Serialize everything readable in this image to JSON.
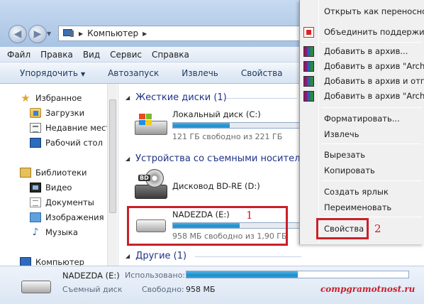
{
  "address": {
    "location": "Компьютер"
  },
  "menubar": {
    "items": [
      "Файл",
      "Правка",
      "Вид",
      "Сервис",
      "Справка"
    ]
  },
  "toolbar": {
    "organize": "Упорядочить",
    "autoplay": "Автозапуск",
    "eject": "Извлечь",
    "properties": "Свойства"
  },
  "navpane": {
    "favorites": "Избранное",
    "downloads": "Загрузки",
    "recent": "Недавние места",
    "desktop": "Рабочий стол",
    "libraries": "Библиотеки",
    "video": "Видео",
    "documents": "Документы",
    "images": "Изображения",
    "music": "Музыка",
    "computer": "Компьютер"
  },
  "content": {
    "hard_drives_header": "Жесткие диски (1)",
    "local_disk": {
      "name": "Локальный диск (C:)",
      "free": "121 ГБ свободно из 221 ГБ",
      "used_fraction": 0.45
    },
    "removable_header": "Устройства со съемными носителями",
    "bd_drive": {
      "name": "Дисковод BD-RE (D:)",
      "badge": "BD"
    },
    "usb_drive": {
      "name": "NADEZDA (E:)",
      "free": "958 МБ свободно из 1,90 ГБ",
      "used_fraction": 0.5
    },
    "other_header": "Другие (1)",
    "callout_1": "1"
  },
  "details": {
    "name": "NADEZDA (E:)",
    "type": "Съемный диск",
    "used_label": "Использовано:",
    "free_label": "Свободно:",
    "free_value": "958 МБ",
    "used_fraction": 0.5
  },
  "context_menu": {
    "open_portable": "Открыть как переносное устройство",
    "merge": "Объединить поддерживаемые файлы",
    "add_archive": "Добавить в архив...",
    "add_archive_named": "Добавить в архив \"Archive.rar\"",
    "add_archive_send": "Добавить в архив и отправить",
    "add_archive_named_send": "Добавить в архив \"Archive.rar\" и отправить",
    "format": "Форматировать...",
    "eject": "Извлечь",
    "cut": "Вырезать",
    "copy": "Копировать",
    "shortcut": "Создать ярлык",
    "rename": "Переименовать",
    "properties": "Свойства",
    "callout_2": "2"
  },
  "watermark": "compgramotnost.ru"
}
